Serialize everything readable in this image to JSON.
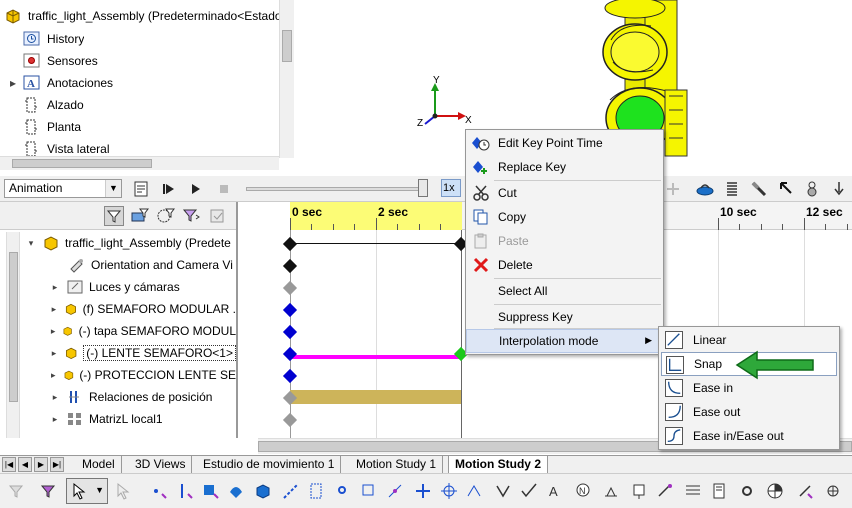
{
  "tree_top": {
    "assembly": "traffic_light_Assembly  (Predeterminado<Estado",
    "items": [
      "History",
      "Sensores",
      "Anotaciones",
      "Alzado",
      "Planta",
      "Vista lateral"
    ]
  },
  "triad": {
    "x": "X",
    "y": "Y",
    "z": "Z"
  },
  "motion": {
    "study_type": "Animation",
    "playback_speed": "1x"
  },
  "ruler": {
    "labels": [
      "0 sec",
      "2 sec",
      "10 sec",
      "12 sec"
    ]
  },
  "motion_tree": {
    "items": [
      "traffic_light_Assembly  (Predete",
      "Orientation and Camera Vi",
      "Luces y cámaras",
      "(f) SEMAFORO MODULAR .",
      "(-) tapa SEMAFORO MODUL",
      "(-) LENTE SEMAFORO<1>",
      "(-) PROTECCION LENTE SE",
      "Relaciones de posición",
      "MatrizL local1"
    ]
  },
  "context_menu": {
    "items": [
      "Edit Key Point Time",
      "Replace Key",
      "Cut",
      "Copy",
      "Paste",
      "Delete",
      "Select All",
      "Suppress Key",
      "Interpolation mode"
    ]
  },
  "submenu": {
    "items": [
      "Linear",
      "Snap",
      "Ease in",
      "Ease out",
      "Ease in/Ease out"
    ],
    "highlighted": "Snap"
  },
  "tabs": [
    "Model",
    "3D Views",
    "Estudio de movimiento 1",
    "Motion Study 1",
    "Motion Study 2"
  ],
  "active_tab": "Motion Study 2",
  "colors": {
    "accent_arrow": "#2ea83a",
    "yellow_body": "#f5f500",
    "green_lens": "#1ee21e",
    "magenta_bar": "#ff00ff",
    "tan_bar": "#cdb45a",
    "key_blue": "#0000d0"
  }
}
